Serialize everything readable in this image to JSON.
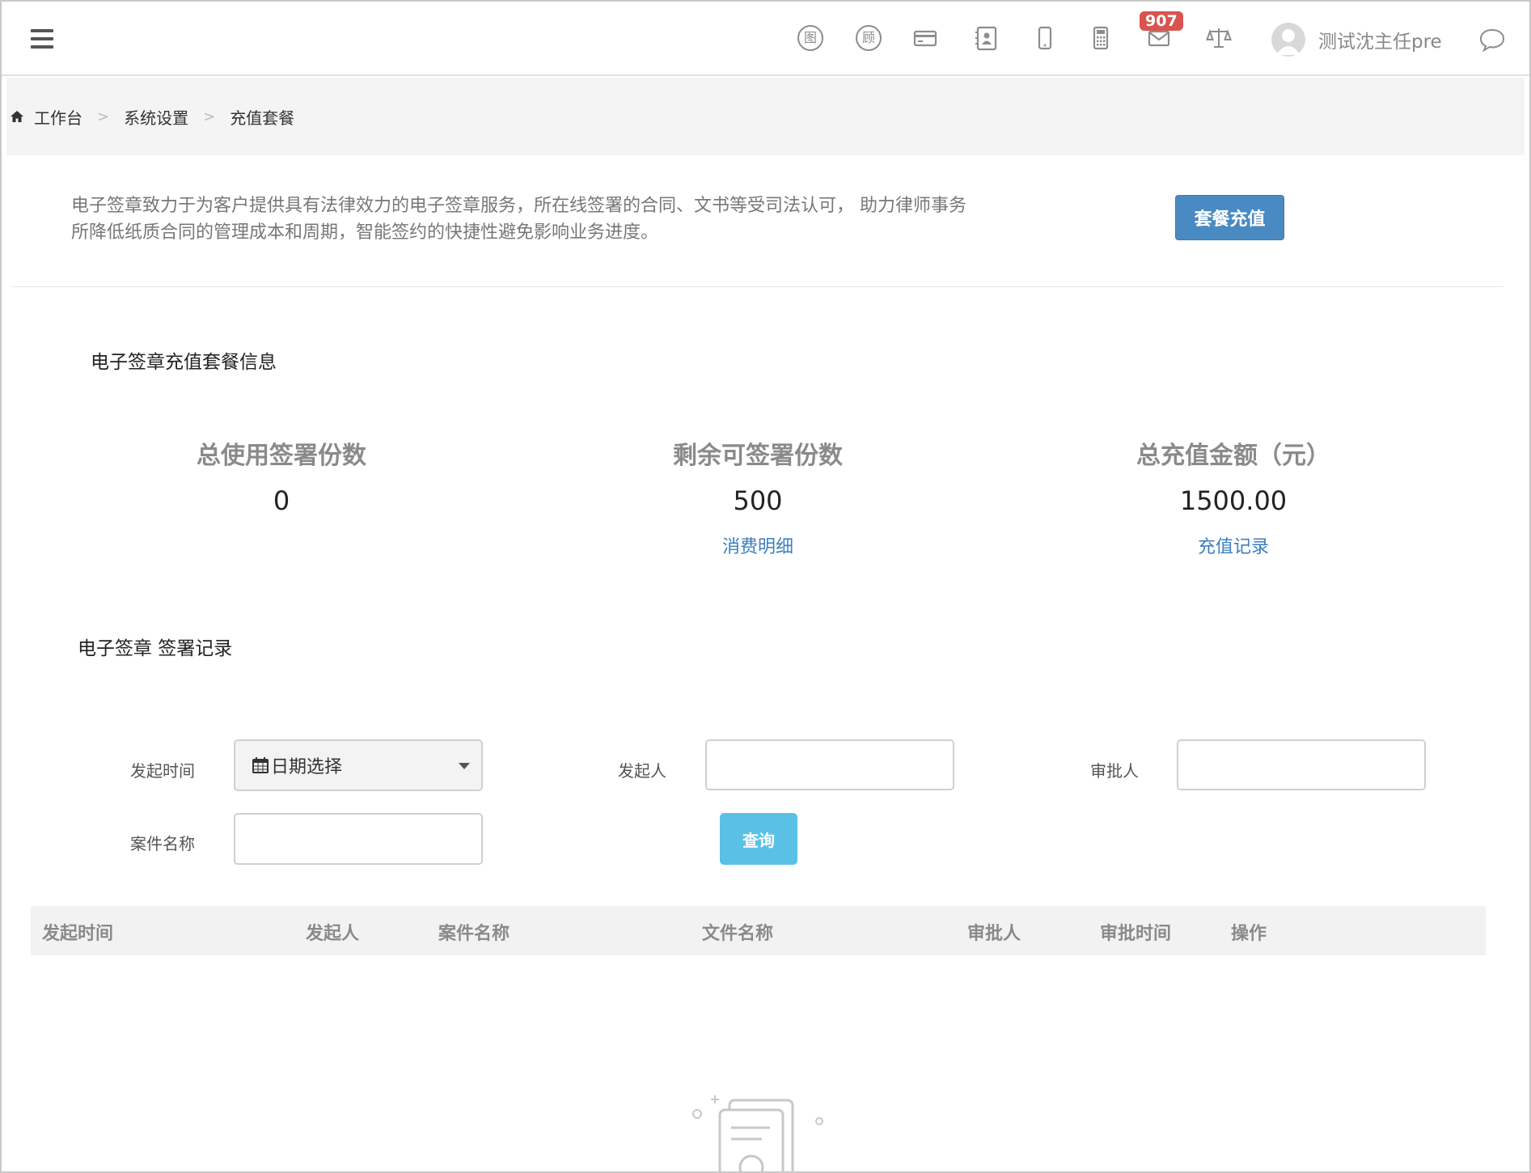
{
  "topbar": {
    "icons": [
      "menu-icon",
      "tu-circle-icon",
      "gu-circle-icon",
      "card-icon",
      "contacts-icon",
      "mobile-icon",
      "calculator-icon",
      "mail-icon",
      "scale-icon",
      "chat-icon"
    ],
    "tu_char": "图",
    "gu_char": "顾",
    "mail_badge": "907",
    "username": "测试沈主任pre"
  },
  "breadcrumb": {
    "items": [
      "工作台",
      "系统设置",
      "充值套餐"
    ],
    "separator": ">"
  },
  "intro": {
    "text": "电子签章致力于为客户提供具有法律效力的电子签章服务，所在线签署的合同、文书等受司法认可， 助力律师事务所降低纸质合同的管理成本和周期，智能签约的快捷性避免影响业务进度。",
    "recharge_button": "套餐充值"
  },
  "package_info": {
    "title": "电子签章充值套餐信息",
    "stats": [
      {
        "label": "总使用签署份数",
        "value": "0",
        "link": ""
      },
      {
        "label": "剩余可签署份数",
        "value": "500",
        "link": "消费明细"
      },
      {
        "label": "总充值金额（元）",
        "value": "1500.00",
        "link": "充值记录"
      }
    ]
  },
  "records": {
    "title": "电子签章 签署记录",
    "filters": {
      "start_time_label": "发起时间",
      "date_select": "日期选择",
      "initiator_label": "发起人",
      "approver_label": "审批人",
      "case_name_label": "案件名称",
      "query_button": "查询"
    },
    "columns": [
      "发起时间",
      "发起人",
      "案件名称",
      "文件名称",
      "审批人",
      "审批时间",
      "操作"
    ]
  },
  "colors": {
    "primary_button": "#4a8ac2",
    "query_button": "#5bc0e6",
    "link": "#3a7fc0",
    "badge": "#d9534f"
  }
}
